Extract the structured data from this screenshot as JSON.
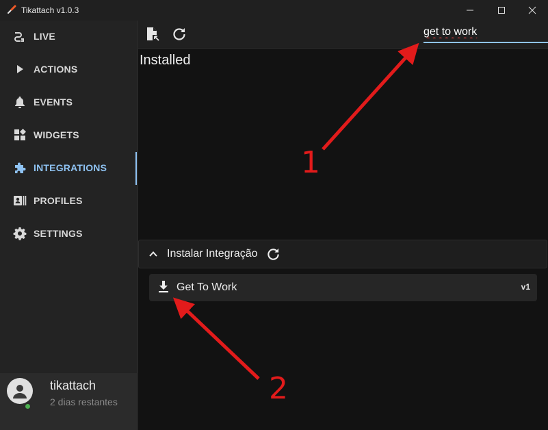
{
  "window": {
    "title": "Tikattach v1.0.3"
  },
  "sidebar": {
    "items": [
      {
        "label": "LIVE",
        "icon": "plug-icon"
      },
      {
        "label": "ACTIONS",
        "icon": "play-icon"
      },
      {
        "label": "EVENTS",
        "icon": "bell-icon"
      },
      {
        "label": "WIDGETS",
        "icon": "widgets-icon"
      },
      {
        "label": "INTEGRATIONS",
        "icon": "puzzle-icon",
        "active": true
      },
      {
        "label": "PROFILES",
        "icon": "profile-card-icon"
      },
      {
        "label": "SETTINGS",
        "icon": "gear-icon"
      }
    ],
    "user": {
      "name": "tikattach",
      "subtitle": "2 dias restantes",
      "status_color": "#4caf50"
    }
  },
  "toolbar": {
    "search_value": "get to work"
  },
  "main": {
    "installed_title": "Installed",
    "install_section": {
      "title": "Instalar Integração",
      "expanded": true,
      "items": [
        {
          "name": "Get To Work",
          "version": "v1"
        }
      ]
    }
  },
  "annotations": [
    {
      "label": "1"
    },
    {
      "label": "2"
    }
  ],
  "colors": {
    "accent": "#8fc3f3",
    "annotation": "#e21b1b"
  }
}
